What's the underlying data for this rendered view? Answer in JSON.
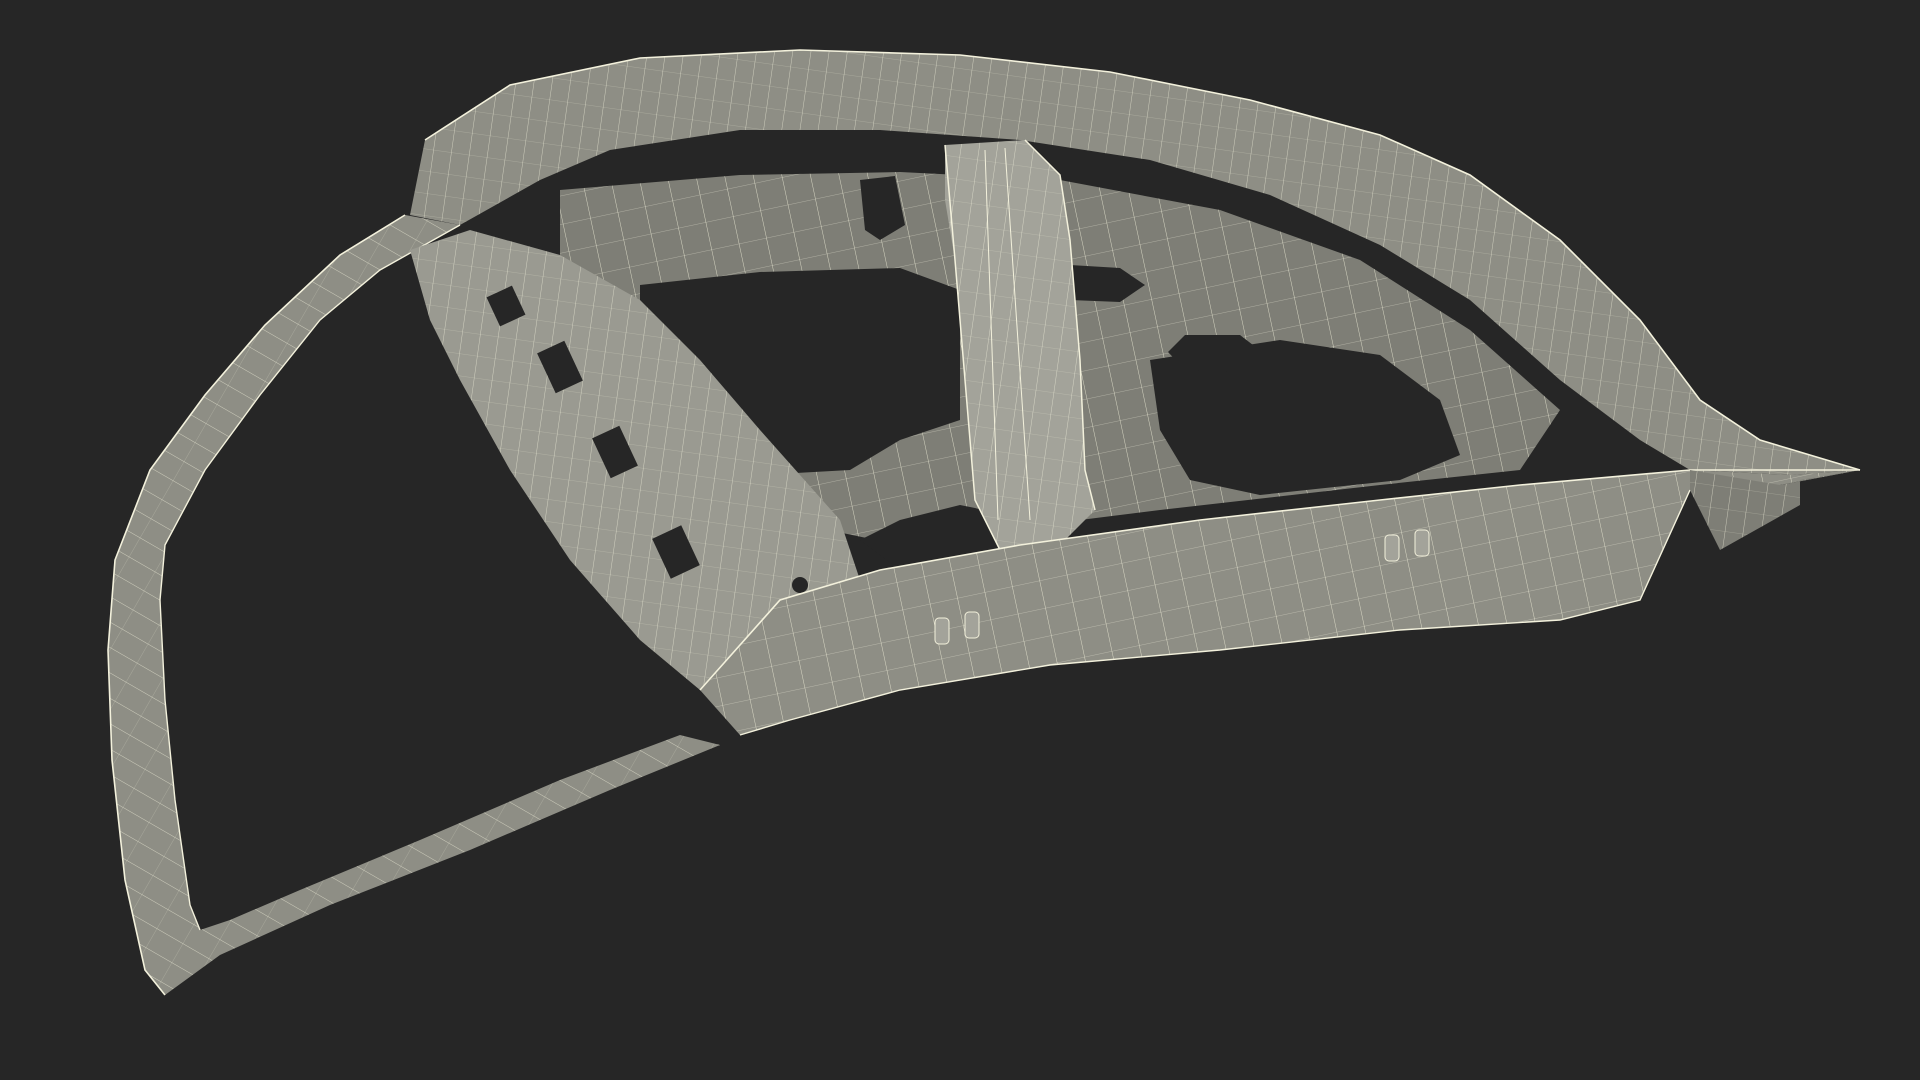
{
  "scene": {
    "background_color": "#262626",
    "model_color": "#8e8e85",
    "model_shadow_color": "#73736b",
    "model_highlight_color": "#a3a39a",
    "wire_color": "#f3f1dc",
    "hole_color": "#262626",
    "render_style": "wireframe-on-shaded",
    "subject_icon": "car-trunk-lid-inner-frame-icon"
  }
}
